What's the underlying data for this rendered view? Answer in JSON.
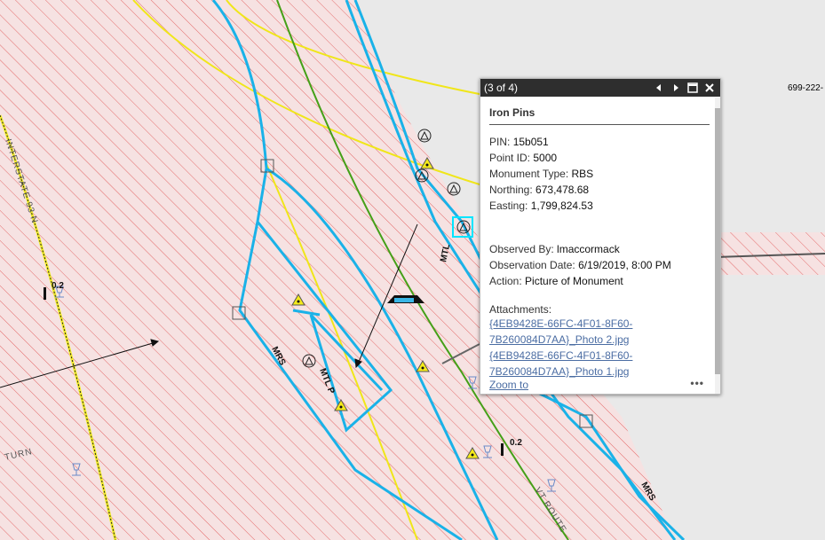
{
  "map": {
    "labels": {
      "interstate": "INTERSTATE 93 N",
      "mrs_left": "MRS",
      "mtl_center": "MTL P",
      "mtl_right": "MTL",
      "mrs_right": "MRS",
      "vt_route": "VT ROUTE",
      "turn": "TURN",
      "marker_left": "0.2",
      "marker_right": "0.2",
      "parcel_id": "699-222-"
    },
    "colors": {
      "parcel_hatch": "#e46a6a",
      "parcel_fill": "#f5e3e3",
      "row_line": "#1ab2e8",
      "yellow_line": "#f0e61a",
      "green_line": "#45a018",
      "background": "#e9e9e9"
    }
  },
  "popup": {
    "counter": "(3 of 4)",
    "title": "Iron Pins",
    "attributes": [
      {
        "label": "PIN:",
        "value": "15b051"
      },
      {
        "label": "Point ID:",
        "value": "5000"
      },
      {
        "label": "Monument Type:",
        "value": "RBS"
      },
      {
        "label": "Northing:",
        "value": "673,478.68"
      },
      {
        "label": "Easting:",
        "value": "1,799,824.53"
      }
    ],
    "observation": [
      {
        "label": "Observed By:",
        "value": "lmaccormack"
      },
      {
        "label": "Observation Date:",
        "value": "6/19/2019, 8:00 PM"
      },
      {
        "label": "Action:",
        "value": "Picture of Monument"
      }
    ],
    "attachments_label": "Attachments:",
    "attachments": [
      {
        "line1": "{4EB9428E-66FC-4F01-8F60-",
        "line2": "7B260084D7AA}_Photo 2.jpg"
      },
      {
        "line1": "{4EB9428E-66FC-4F01-8F60-",
        "line2": "7B260084D7AA}_Photo 1.jpg"
      }
    ],
    "zoom_to": "Zoom to",
    "more": "•••",
    "icons": [
      "prev-arrow-icon",
      "next-arrow-icon",
      "maximize-icon",
      "close-icon"
    ]
  }
}
